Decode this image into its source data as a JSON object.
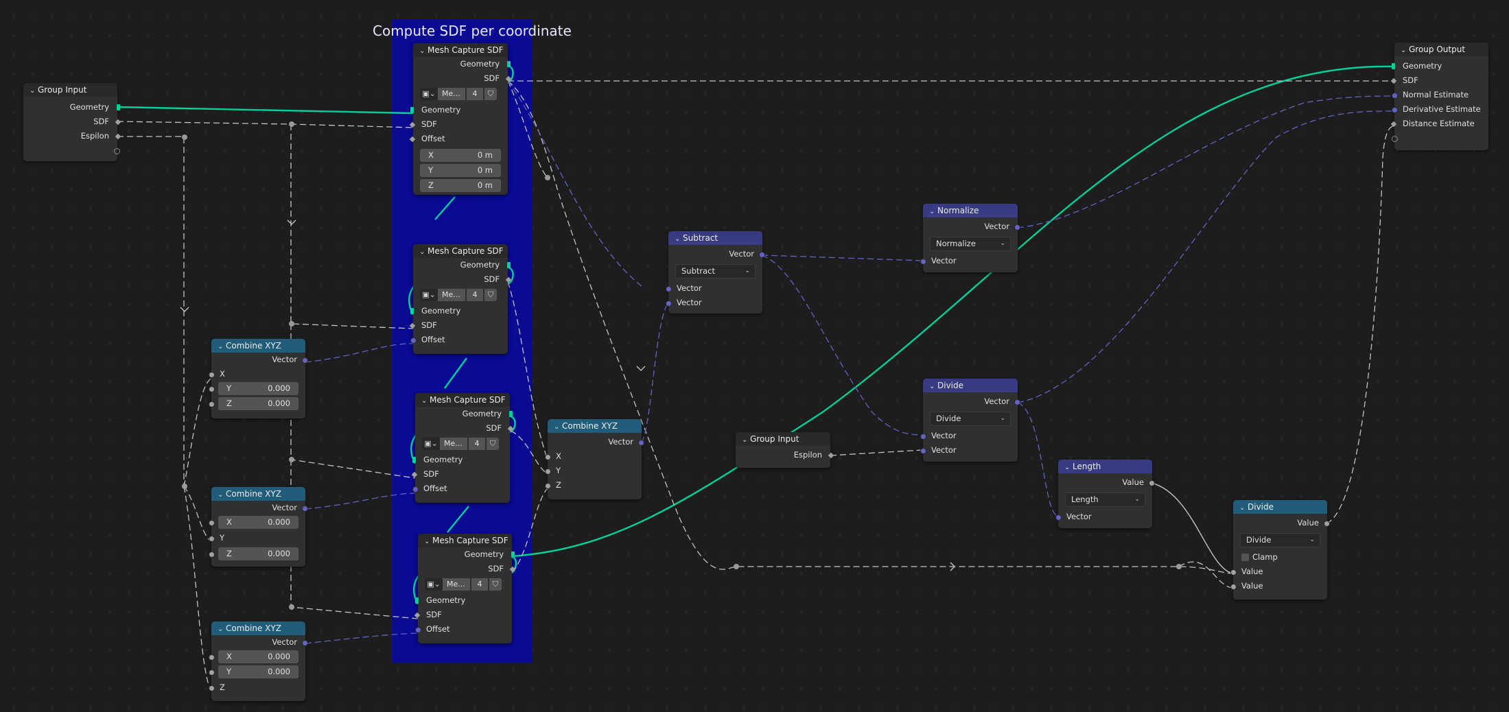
{
  "colors": {
    "geometry": "#00d19a",
    "vector": "#6363c7",
    "float": "#a1a1a1",
    "frame": "#0a0a92",
    "header_input_output": "#292929",
    "header_converter": "#215d7a",
    "header_vector_math": "#393b82"
  },
  "frame": {
    "label": "Compute SDF per coordinate"
  },
  "group_input_main": {
    "title": "Group Input",
    "geometry": "Geometry",
    "sdf": "SDF",
    "epsilon": "Espilon"
  },
  "group_input_small": {
    "title": "Group Input",
    "epsilon": "Espilon"
  },
  "group_output": {
    "title": "Group Output",
    "geometry": "Geometry",
    "sdf": "SDF",
    "normal": "Normal Estimate",
    "derivative": "Derivative Estimate",
    "distance": "Distance Estimate"
  },
  "mesh_capture": [
    {
      "title": "Mesh Capture SDF",
      "out_geometry": "Geometry",
      "out_sdf": "SDF",
      "object_name": "Me...",
      "count": "4",
      "in_geometry": "Geometry",
      "in_sdf": "SDF",
      "in_offset": "Offset",
      "x_label": "X",
      "x_value": "0 m",
      "y_label": "Y",
      "y_value": "0 m",
      "z_label": "Z",
      "z_value": "0 m"
    },
    {
      "title": "Mesh Capture SDF",
      "out_geometry": "Geometry",
      "out_sdf": "SDF",
      "object_name": "Me...",
      "count": "4",
      "in_geometry": "Geometry",
      "in_sdf": "SDF",
      "in_offset": "Offset"
    },
    {
      "title": "Mesh Capture SDF",
      "out_geometry": "Geometry",
      "out_sdf": "SDF",
      "object_name": "Me...",
      "count": "4",
      "in_geometry": "Geometry",
      "in_sdf": "SDF",
      "in_offset": "Offset"
    },
    {
      "title": "Mesh Capture SDF",
      "out_geometry": "Geometry",
      "out_sdf": "SDF",
      "object_name": "Me...",
      "count": "4",
      "in_geometry": "Geometry",
      "in_sdf": "SDF",
      "in_offset": "Offset"
    }
  ],
  "combine_x": {
    "title": "Combine XYZ",
    "vector": "Vector",
    "x": "X",
    "y_label": "Y",
    "y_value": "0.000",
    "z_label": "Z",
    "z_value": "0.000"
  },
  "combine_y": {
    "title": "Combine XYZ",
    "vector": "Vector",
    "x_label": "X",
    "x_value": "0.000",
    "y": "Y",
    "z_label": "Z",
    "z_value": "0.000"
  },
  "combine_z": {
    "title": "Combine XYZ",
    "vector": "Vector",
    "x_label": "X",
    "x_value": "0.000",
    "y_label": "Y",
    "y_value": "0.000",
    "z": "Z"
  },
  "combine_main": {
    "title": "Combine XYZ",
    "vector": "Vector",
    "x": "X",
    "y": "Y",
    "z": "Z"
  },
  "subtract": {
    "title": "Subtract",
    "out": "Vector",
    "operation": "Subtract",
    "in1": "Vector",
    "in2": "Vector"
  },
  "normalize": {
    "title": "Normalize",
    "out": "Vector",
    "operation": "Normalize",
    "in1": "Vector"
  },
  "divide_vec": {
    "title": "Divide",
    "out": "Vector",
    "operation": "Divide",
    "in1": "Vector",
    "in2": "Vector"
  },
  "length": {
    "title": "Length",
    "out": "Value",
    "operation": "Length",
    "in1": "Vector"
  },
  "divide_math": {
    "title": "Divide",
    "out": "Value",
    "operation": "Divide",
    "clamp": "Clamp",
    "in1": "Value",
    "in2": "Value"
  }
}
